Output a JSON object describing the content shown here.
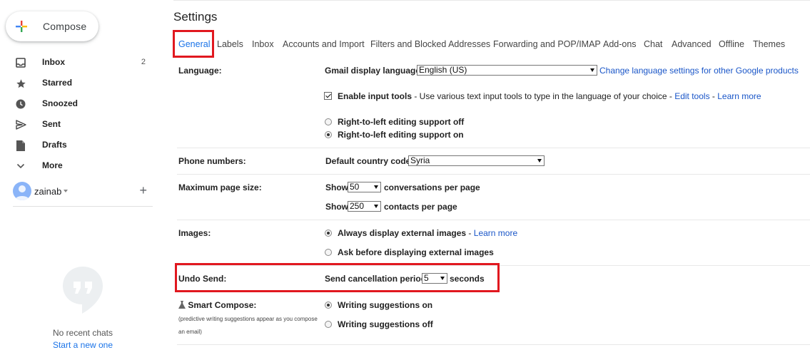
{
  "sidebar": {
    "compose_label": "Compose",
    "items": [
      {
        "label": "Inbox",
        "count": "2",
        "icon": "inbox-icon"
      },
      {
        "label": "Starred",
        "count": "",
        "icon": "star-icon"
      },
      {
        "label": "Snoozed",
        "count": "",
        "icon": "clock-icon"
      },
      {
        "label": "Sent",
        "count": "",
        "icon": "send-icon"
      },
      {
        "label": "Drafts",
        "count": "",
        "icon": "draft-icon"
      },
      {
        "label": "More",
        "count": "",
        "icon": "chevron-down-icon"
      }
    ],
    "account_name": "zainab",
    "no_chats": "No recent chats",
    "start_chat": "Start a new one"
  },
  "settings": {
    "title": "Settings",
    "tabs": [
      "General",
      "Labels",
      "Inbox",
      "Accounts and Import",
      "Filters and Blocked Addresses",
      "Forwarding and POP/IMAP",
      "Add-ons",
      "Chat",
      "Advanced",
      "Offline",
      "Themes"
    ],
    "language": {
      "label": "Language:",
      "display_label": "Gmail display language:",
      "display_value": "English (US)",
      "change_link": "Change language settings for other Google products",
      "input_tools_label": "Enable input tools",
      "input_tools_desc": " - Use various text input tools to type in the language of your choice - ",
      "edit_tools": "Edit tools",
      "sep": " - ",
      "learn_more": "Learn more",
      "rtl_off": "Right-to-left editing support off",
      "rtl_on": "Right-to-left editing support on"
    },
    "phone": {
      "label": "Phone numbers:",
      "country_label": "Default country code:",
      "country_value": "Syria"
    },
    "page_size": {
      "label": "Maximum page size:",
      "show": "Show",
      "conv_value": "50",
      "conv_suffix": "conversations per page",
      "contacts_value": "250",
      "contacts_suffix": "contacts per page"
    },
    "images": {
      "label": "Images:",
      "always": "Always display external images",
      "sep": " - ",
      "learn_more": "Learn more",
      "ask": "Ask before displaying external images"
    },
    "undo_send": {
      "label": "Undo Send:",
      "period_label": "Send cancellation period:",
      "period_value": "5",
      "suffix": "seconds"
    },
    "smart_compose": {
      "label": "Smart Compose:",
      "note_line1": "(predictive writing suggestions appear as you compose",
      "note_line2": "an email)",
      "on": "Writing suggestions on",
      "off": "Writing suggestions off"
    }
  },
  "colors": {
    "accent": "#1a73e8",
    "highlight": "#e1181f"
  }
}
